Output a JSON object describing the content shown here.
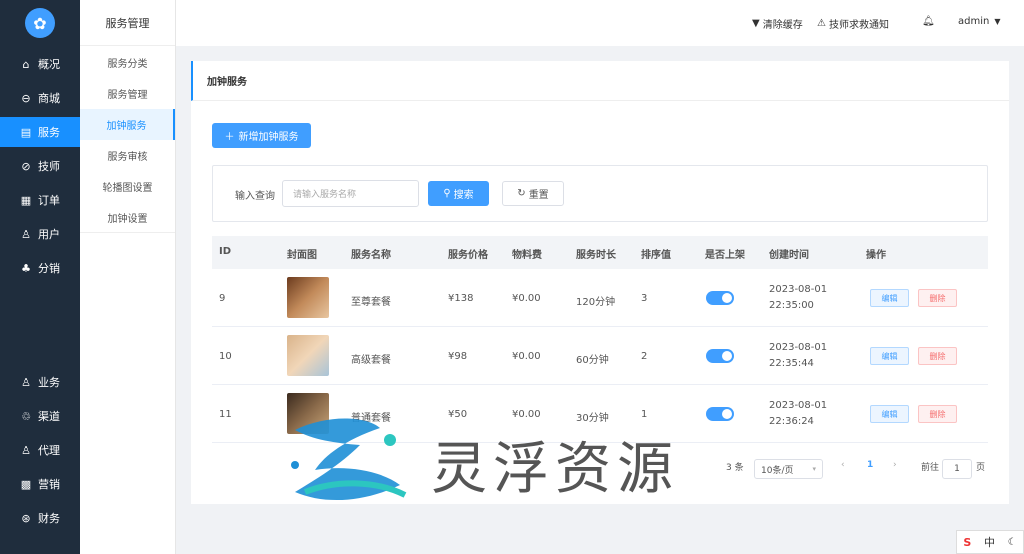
{
  "sidebar": {
    "items": [
      {
        "label": "概况",
        "icon": "⌂"
      },
      {
        "label": "商城",
        "icon": "⊖"
      },
      {
        "label": "服务",
        "icon": "▤"
      },
      {
        "label": "技师",
        "icon": "⊘"
      },
      {
        "label": "订单",
        "icon": "▦"
      },
      {
        "label": "用户",
        "icon": "♙"
      },
      {
        "label": "分销",
        "icon": "♣"
      },
      {
        "label": "业务",
        "icon": "♙"
      },
      {
        "label": "渠道",
        "icon": "♲"
      },
      {
        "label": "代理",
        "icon": "♙"
      },
      {
        "label": "营销",
        "icon": "▩"
      },
      {
        "label": "财务",
        "icon": "⊛"
      }
    ]
  },
  "subnav": {
    "title": "服务管理",
    "items": [
      "服务分类",
      "服务管理",
      "加钟服务",
      "服务审核",
      "轮播图设置",
      "加钟设置"
    ]
  },
  "topbar": {
    "clear_cache": "清除缓存",
    "notice": "技师求救通知",
    "user": "admin",
    "accent": "#1890ff"
  },
  "page": {
    "title": "加钟服务",
    "add_button": "新增加钟服务",
    "search_label": "输入查询",
    "search_placeholder": "请输入服务名称",
    "search_button": "搜索",
    "reset_button": "重置"
  },
  "table": {
    "headers": [
      "ID",
      "封面图",
      "服务名称",
      "服务价格",
      "物料费",
      "服务时长",
      "排序值",
      "是否上架",
      "创建时间",
      "操作"
    ],
    "rows": [
      {
        "id": "9",
        "name": "至尊套餐",
        "price": "¥138",
        "material": "¥0.00",
        "duration": "120分钟",
        "sort": "3",
        "on": true,
        "date": "2023-08-01",
        "time": "22:35:00"
      },
      {
        "id": "10",
        "name": "高级套餐",
        "price": "¥98",
        "material": "¥0.00",
        "duration": "60分钟",
        "sort": "2",
        "on": true,
        "date": "2023-08-01",
        "time": "22:35:44"
      },
      {
        "id": "11",
        "name": "普通套餐",
        "price": "¥50",
        "material": "¥0.00",
        "duration": "30分钟",
        "sort": "1",
        "on": true,
        "date": "2023-08-01",
        "time": "22:36:24"
      }
    ],
    "edit_label": "编辑",
    "delete_label": "删除"
  },
  "pagination": {
    "total": "3 条",
    "page_size": "10条/页",
    "current": "1",
    "goto_label": "前往",
    "goto_value": "1",
    "page_unit": "页"
  },
  "watermark": {
    "text": "灵浮资源"
  },
  "ime": {
    "label": "中"
  }
}
